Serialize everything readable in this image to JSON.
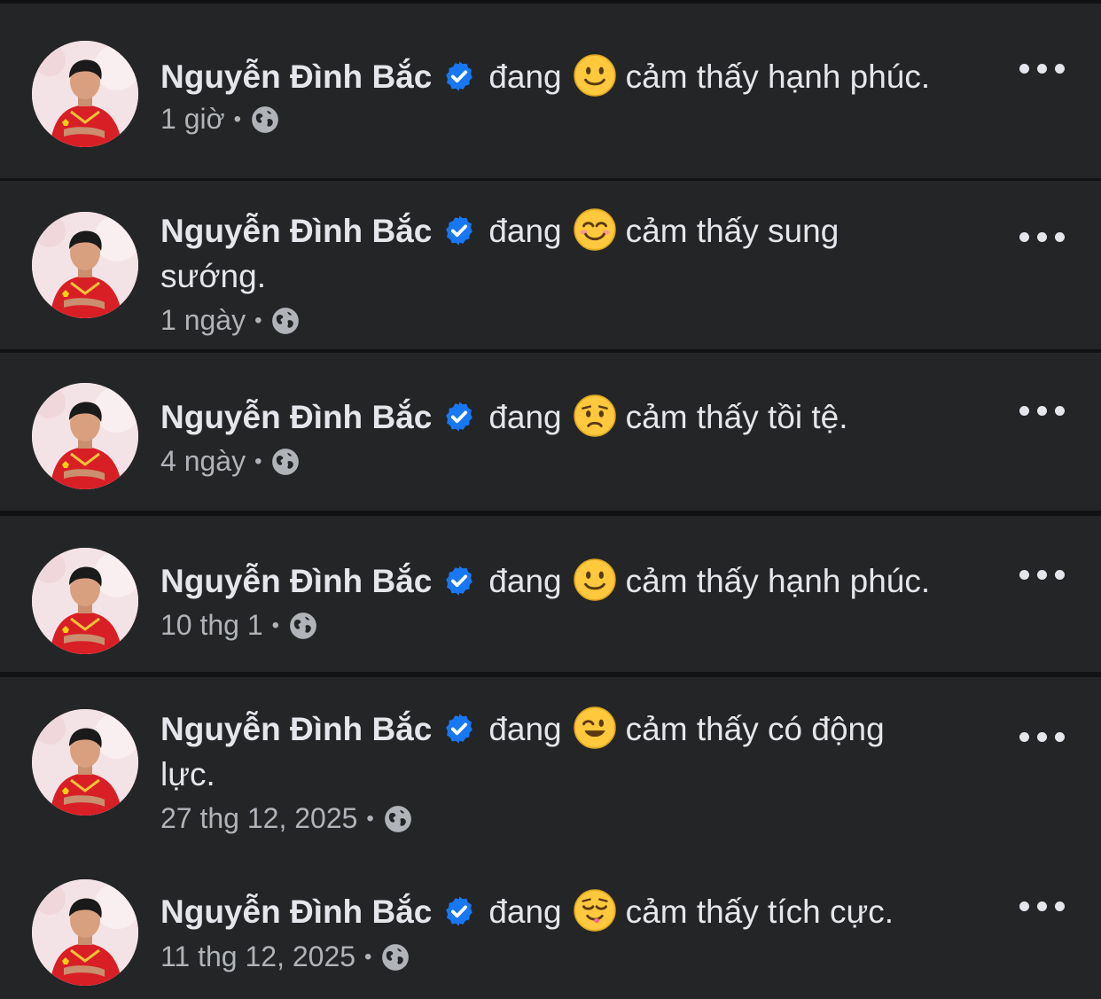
{
  "author": {
    "name": "Nguyễn Đình Bắc",
    "verified": true
  },
  "colors": {
    "background": "#242526",
    "divider": "#111214",
    "text": "#e4e6eb",
    "muted": "#b0b3b8",
    "verified_badge": "#1877f2",
    "emoji_yellow": "#ffc83d"
  },
  "posts": [
    {
      "verb": "đang",
      "emoji": "slightly-smiling-face",
      "feeling_line1": "cảm thấy hạnh phúc.",
      "feeling_line2": "",
      "time": "1 giờ",
      "audience_icon": "globe-icon"
    },
    {
      "verb": "đang",
      "emoji": "smiling-face-with-smiling-eyes",
      "feeling_line1": "cảm thấy sung",
      "feeling_line2": "sướng.",
      "time": "1 ngày",
      "audience_icon": "globe-icon"
    },
    {
      "verb": "đang",
      "emoji": "worried-face",
      "feeling_line1": "cảm thấy tồi tệ.",
      "feeling_line2": "",
      "time": "4 ngày",
      "audience_icon": "globe-icon"
    },
    {
      "verb": "đang",
      "emoji": "slightly-smiling-face",
      "feeling_line1": "cảm thấy hạnh phúc.",
      "feeling_line2": "",
      "time": "10 thg 1",
      "audience_icon": "globe-icon"
    },
    {
      "verb": "đang",
      "emoji": "winking-smiling-face",
      "feeling_line1": "cảm thấy có động",
      "feeling_line2": "lực.",
      "time": "27 thg 12, 2025",
      "audience_icon": "globe-icon"
    },
    {
      "verb": "đang",
      "emoji": "relieved-face",
      "feeling_line1": "cảm thấy tích cực.",
      "feeling_line2": "",
      "time": "11 thg 12, 2025",
      "audience_icon": "globe-icon"
    }
  ],
  "more_icon": "more-options-icon",
  "separator": "•"
}
